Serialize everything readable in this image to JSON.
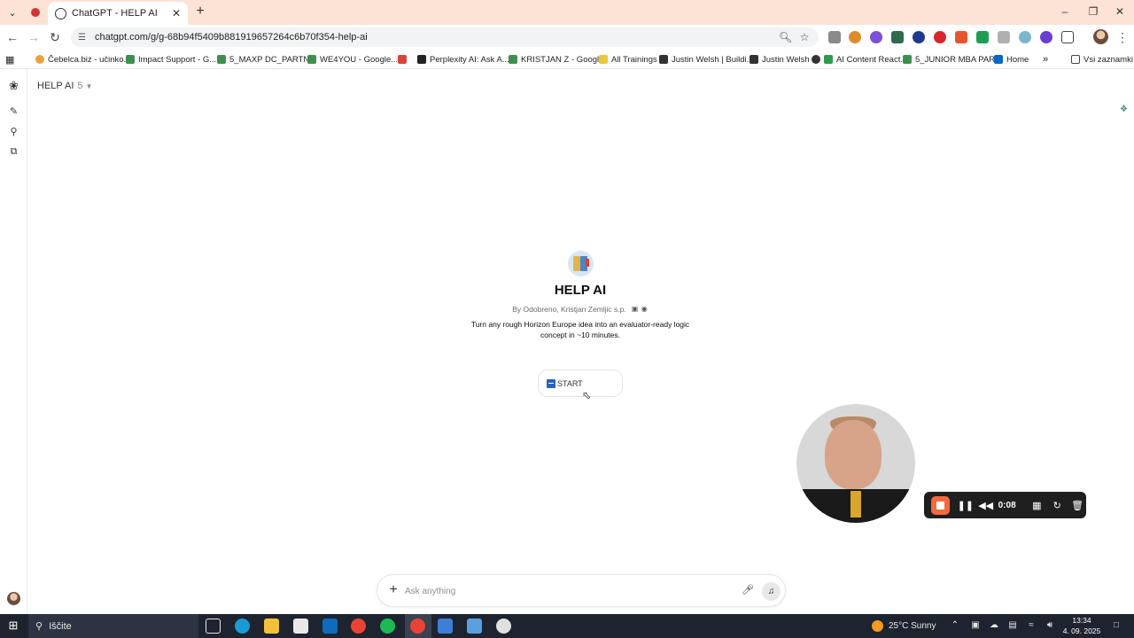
{
  "browser": {
    "tab_title": "ChatGPT - HELP AI",
    "address": "chatgpt.com/g/g-68b94f5409b881919657264c6b70f354-help-ai",
    "bookmarks": [
      "Čebelca.biz - učinko...",
      "Impact Support - G...",
      "5_MAXP DC_PARTN...",
      "WE4YOU - Google...",
      "",
      "Perplexity AI: Ask A...",
      "KRISTJAN Z - Googl...",
      "All Trainings",
      "Justin Welsh | Buildi...",
      "Justin Welsh",
      "AI Content React...",
      "5_JUNIOR MBA PAR...",
      "Home"
    ],
    "all_bookmarks_label": "Vsi zaznamki",
    "icons": {
      "tab_menu": "chevron-down-icon",
      "record": "record-icon",
      "back": "back-arrow-icon",
      "forward": "forward-arrow-icon",
      "reload": "reload-icon",
      "zoom": "zoom-icon",
      "bookmark_star": "star-icon"
    }
  },
  "app": {
    "gpt_selector": {
      "name": "HELP AI",
      "version": "5"
    },
    "gpt": {
      "name": "HELP AI",
      "byline": "By Odobreno, Kristjan Zemljic s.p.",
      "description": "Turn any rough Horizon Europe idea into an evaluator-ready logic concept in ~10 minutes."
    },
    "starter_label": "START",
    "composer": {
      "placeholder": "Ask anything",
      "value": ""
    }
  },
  "recorder": {
    "time": "0:08"
  },
  "taskbar": {
    "search_label": "Iščite",
    "weather": "25°C  Sunny",
    "time": "13:34",
    "date": "4. 09. 2025"
  },
  "colors": {
    "tabbar_bg": "#fce3d5",
    "recorder_stop": "#f26a3d",
    "taskbar_bg": "#1d2430"
  }
}
